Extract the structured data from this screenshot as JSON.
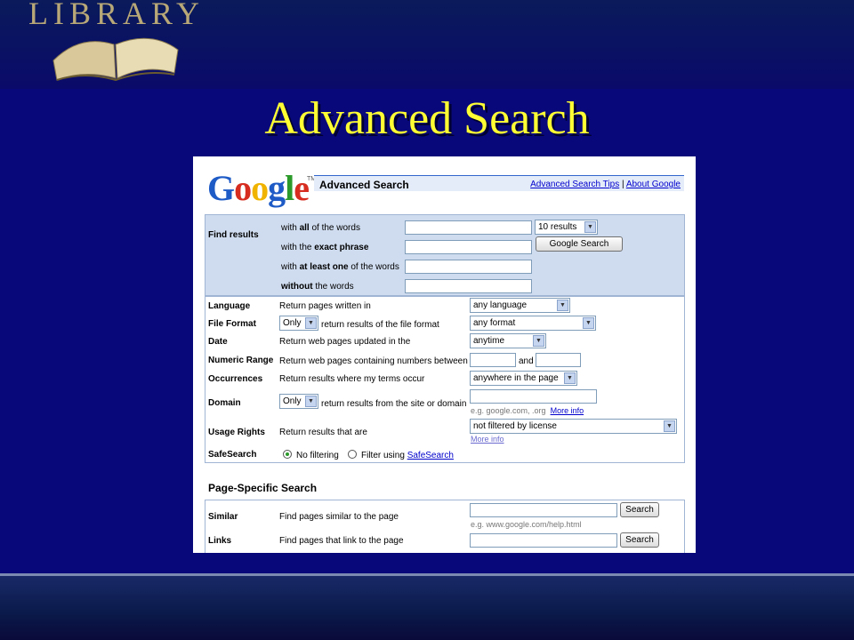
{
  "slide": {
    "brand": "LIBRARY",
    "title": "Advanced Search"
  },
  "google": {
    "logo_letters": [
      "G",
      "o",
      "o",
      "g",
      "l",
      "e"
    ],
    "tm": "TM",
    "bar_title": "Advanced Search",
    "link_tips": "Advanced Search Tips",
    "link_sep": "|",
    "link_about": "About Google"
  },
  "find": {
    "label": "Find results",
    "rows": [
      {
        "pre": "with ",
        "bold": "all",
        "post": " of the words"
      },
      {
        "pre": "with the ",
        "bold": "exact phrase",
        "post": ""
      },
      {
        "pre": "with ",
        "bold": "at least one",
        "post": " of the words"
      },
      {
        "pre": "",
        "bold": "without",
        "post": " the words"
      }
    ],
    "results_select": "10 results",
    "search_button": "Google Search"
  },
  "options": {
    "language": {
      "label": "Language",
      "desc": "Return pages written in",
      "value": "any language"
    },
    "file_format": {
      "label": "File Format",
      "qual": "Only",
      "desc": "return results of the file format",
      "value": "any format"
    },
    "date": {
      "label": "Date",
      "desc": "Return web pages updated in the",
      "value": "anytime"
    },
    "numeric": {
      "label": "Numeric Range",
      "desc": "Return web pages containing numbers between",
      "and": "and"
    },
    "occurrences": {
      "label": "Occurrences",
      "desc": "Return results where my terms occur",
      "value": "anywhere in the page"
    },
    "domain": {
      "label": "Domain",
      "qual": "Only",
      "desc": "return results from the site or domain",
      "hint": "e.g. google.com, .org",
      "more": "More info"
    },
    "usage": {
      "label": "Usage Rights",
      "desc": "Return results that are",
      "value": "not filtered by license",
      "more": "More info"
    },
    "safesearch": {
      "label": "SafeSearch",
      "opt1": "No filtering",
      "opt2": "Filter using ",
      "opt2_link": "SafeSearch"
    }
  },
  "page_specific": {
    "title": "Page-Specific Search",
    "similar": {
      "label": "Similar",
      "desc": "Find pages similar to the page",
      "hint": "e.g. www.google.com/help.html",
      "button": "Search"
    },
    "links": {
      "label": "Links",
      "desc": "Find pages that link to the page",
      "button": "Search"
    }
  }
}
